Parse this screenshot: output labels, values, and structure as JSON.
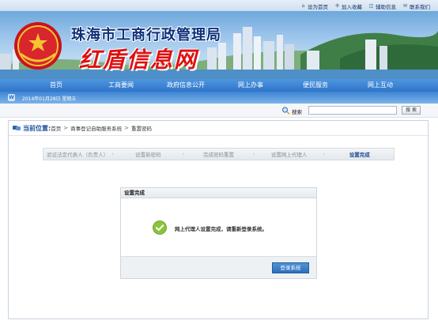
{
  "utility": {
    "links": [
      {
        "label": "设为首页",
        "icon": "home-icon",
        "glyph": "⌂"
      },
      {
        "label": "加入收藏",
        "icon": "favorite-icon",
        "glyph": "✣"
      },
      {
        "label": "辅助信息",
        "icon": "accessibility-icon",
        "glyph": "◫"
      },
      {
        "label": "联系我们",
        "icon": "mail-icon",
        "glyph": "✉"
      }
    ]
  },
  "banner": {
    "agency_title": "珠海市工商行政管理局",
    "slogan": "红盾信息网"
  },
  "nav": {
    "items": [
      "首页",
      "工商要闻",
      "政府信息公开",
      "网上办事",
      "便民服务",
      "网上互动"
    ]
  },
  "date_bar": {
    "icon_glyph": "W",
    "date_text": "2014年01月28日 星期五"
  },
  "search": {
    "label": "搜索",
    "button": "搜 索",
    "value": ""
  },
  "breadcrumb": {
    "label": "当前位置:",
    "items": [
      "首页",
      "商事登记自助服务系统",
      "重置密码"
    ],
    "separator": ">"
  },
  "steps": {
    "items": [
      "验证法定代表人（负责人）",
      "设置新密码",
      "完成密码重置",
      "设置网上代理人",
      "设置完成"
    ],
    "active_index": 4,
    "arrow": "›"
  },
  "result": {
    "title": "设置完成",
    "message": "网上代理人设置完成，请重新登录系统。",
    "button": "登录系统"
  },
  "colors": {
    "nav_blue": "#2f75c9",
    "title_blue": "#0d2f7a",
    "slogan_red": "#e01010",
    "success_green": "#8ac33c"
  }
}
